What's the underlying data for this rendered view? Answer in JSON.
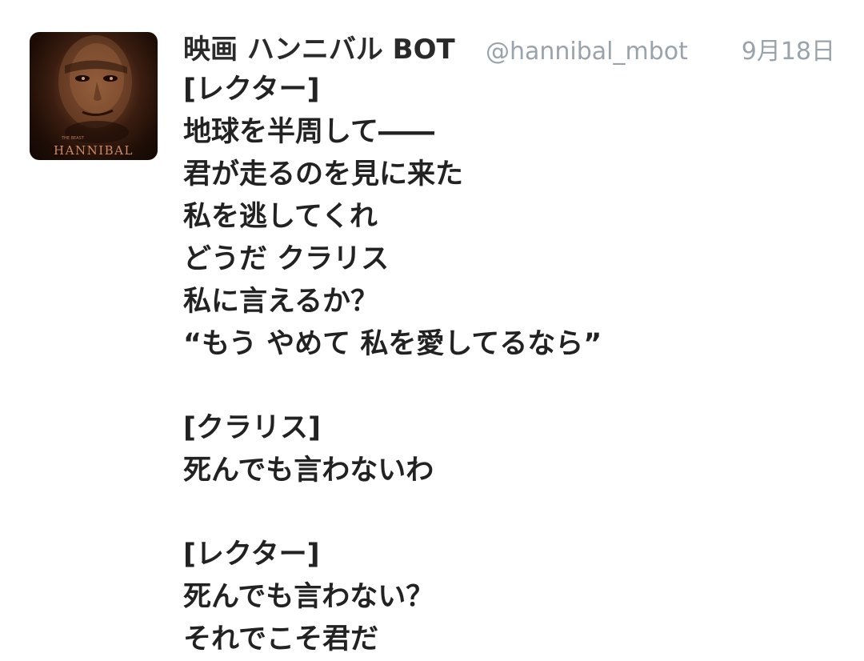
{
  "tweet": {
    "display_name": "映画 ハンニバル BOT",
    "handle": "@hannibal_mbot",
    "timestamp": "9月18日",
    "avatar": {
      "title": "HANNIBAL",
      "small_text": "THE BEAST"
    },
    "lines": [
      "[レクター]",
      "地球を半周して――",
      "君が走るのを見に来た",
      "私を逃してくれ",
      "どうだ クラリス",
      "私に言えるか？",
      "“もう やめて 私を愛してるなら”",
      "",
      "[クラリス]",
      "死んでも言わないわ",
      "",
      "[レクター]",
      "死んでも言わない？",
      "それでこそ君だ"
    ]
  }
}
